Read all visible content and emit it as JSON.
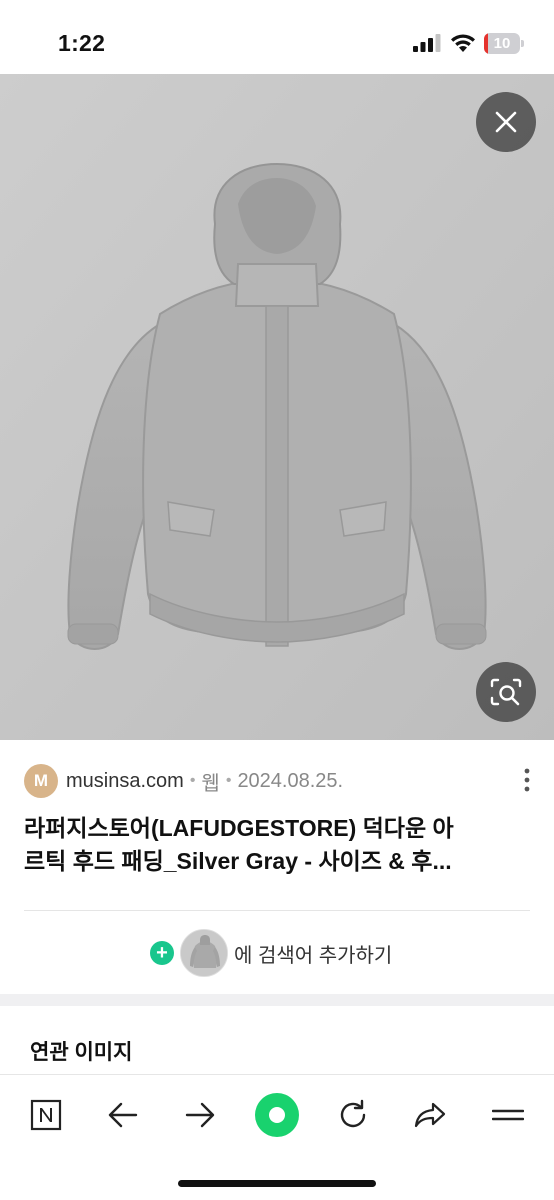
{
  "status_bar": {
    "time": "1:22",
    "battery_level": "10",
    "battery_fraction": 0.1,
    "battery_color": "#e5322d"
  },
  "viewer": {
    "background_color": "#c8c8c8",
    "close_icon": "close-icon",
    "lens_icon": "image-search-icon"
  },
  "result": {
    "favicon_letter": "M",
    "favicon_color": "#d8b48a",
    "domain": "musinsa.com",
    "type": "웹",
    "date": "2024.08.25.",
    "title_line1": "라퍼지스토어(LAFUDGESTORE) 덕다운 아",
    "title_line2": "르틱 후드 패딩_Silver Gray - 사이즈 & 후..."
  },
  "add_keyword": {
    "label": "에 검색어 추가하기",
    "accent_color": "#19c68d"
  },
  "related": {
    "title": "연관 이미지"
  },
  "toolbar": {
    "items": [
      "naver-home-icon",
      "back-arrow-icon",
      "forward-arrow-icon",
      "green-dot-icon",
      "refresh-icon",
      "share-icon",
      "menu-icon"
    ],
    "accent_color": "#19d26e"
  }
}
